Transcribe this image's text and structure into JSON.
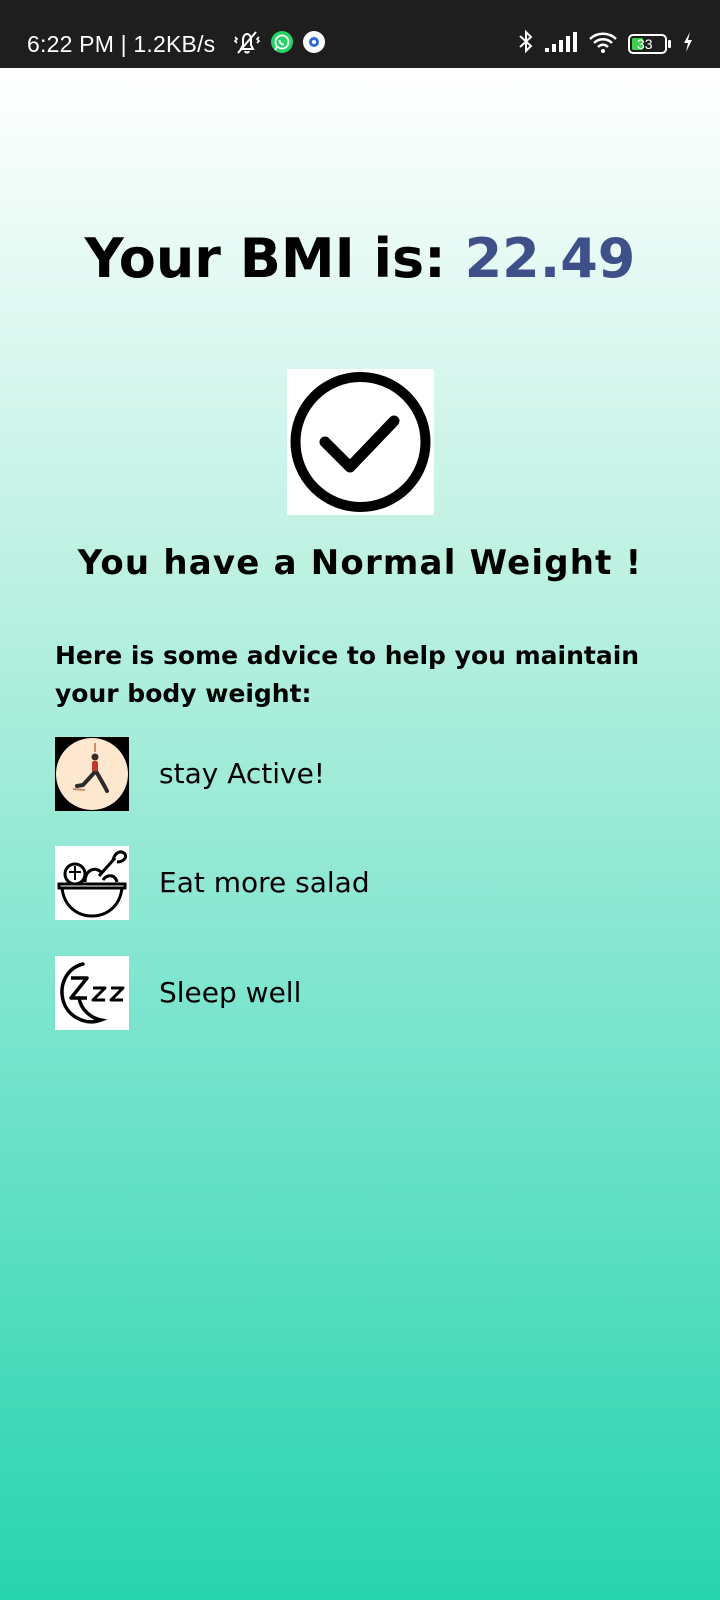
{
  "status_bar": {
    "time_speed": "6:22 PM | 1.2KB/s",
    "battery_level": "33",
    "icons_left": [
      "vibrate-off-icon",
      "whatsapp-icon",
      "app-notification-icon"
    ],
    "icons_right": [
      "bluetooth-icon",
      "signal-icon",
      "wifi-icon",
      "battery-icon",
      "charging-icon"
    ]
  },
  "result": {
    "bmi_prefix": "Your BMI is: ",
    "bmi_value": "22.49",
    "bmi_value_color": "#3d5089",
    "status_icon": "check-circle-icon",
    "status_text": "You have a Normal Weight !"
  },
  "advice": {
    "intro": "Here is some advice to help you maintain your body weight:",
    "tips": [
      {
        "icon": "yoga-pose-icon",
        "text": "stay Active!"
      },
      {
        "icon": "salad-bowl-icon",
        "text": "Eat more salad"
      },
      {
        "icon": "sleep-moon-icon",
        "text": "Sleep well"
      }
    ]
  },
  "colors": {
    "gradient_top": "#ffffff",
    "gradient_bottom": "#27d4ae",
    "status_bar_bg": "#1e1e1e"
  }
}
